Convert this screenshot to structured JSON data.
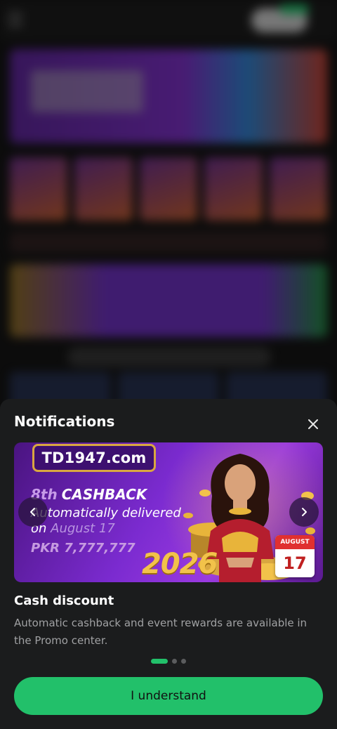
{
  "background": {
    "logo_text": ""
  },
  "sheet": {
    "title": "Notifications",
    "close_icon": "close-icon"
  },
  "banner": {
    "logo": "TD1947.com",
    "line1_prefix": "8th",
    "line1_main": "CASHBACK",
    "line2": "Automatically delivered",
    "line3_prefix": "on",
    "line3_date": "August 17",
    "prize": "PKR 7,777,777",
    "year": "2026",
    "calendar_month": "AUGUST",
    "calendar_day": "17",
    "prev_icon": "chevron-left-icon",
    "next_icon": "chevron-right-icon"
  },
  "content": {
    "title": "Cash discount",
    "description": "Automatic cashback and event rewards are available in the Promo center."
  },
  "pagination": {
    "total": 3,
    "active_index": 0
  },
  "cta": {
    "label": "I understand"
  },
  "colors": {
    "accent": "#22c06a",
    "sheet_bg": "#1b1c1d",
    "text_primary": "#ffffff",
    "text_secondary": "#a0a1a3"
  }
}
